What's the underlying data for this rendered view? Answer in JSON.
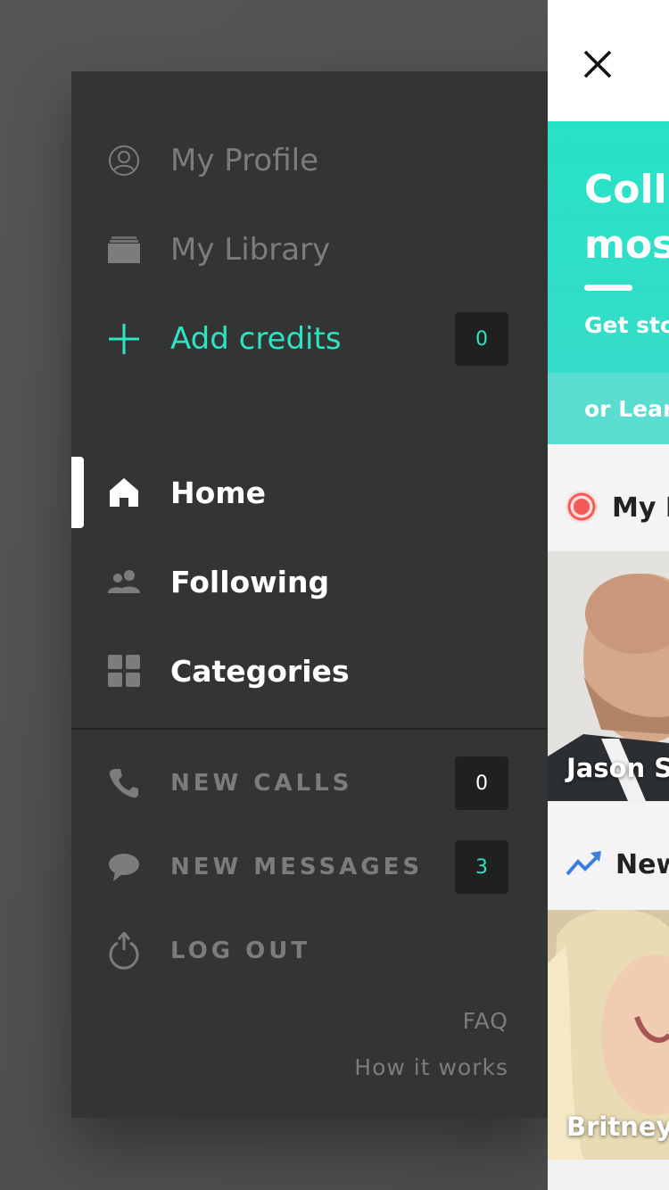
{
  "drawer": {
    "profile_label": "My Profile",
    "library_label": "My Library",
    "add_credits_label": "Add credits",
    "credits_count": "0",
    "nav": {
      "home": "Home",
      "following": "Following",
      "categories": "Categories"
    },
    "new_calls_label": "NEW CALLS",
    "new_calls_count": "0",
    "new_messages_label": "NEW MESSAGES",
    "new_messages_count": "3",
    "logout_label": "LOG OUT",
    "faq_label": "FAQ",
    "how_it_works_label": "How it works"
  },
  "panel": {
    "hero_title": "Colli\nmos",
    "hero_subtitle": "Get sto",
    "learn_text": "or Lear",
    "section1_title": "My F",
    "card1_name": "Jason S",
    "section2_title": "New",
    "card2_name": "Britney"
  },
  "colors": {
    "accent": "#2ee3c3",
    "drawer_bg": "#333434",
    "live_red": "#f25c54",
    "trend_blue": "#3b7fe0"
  }
}
